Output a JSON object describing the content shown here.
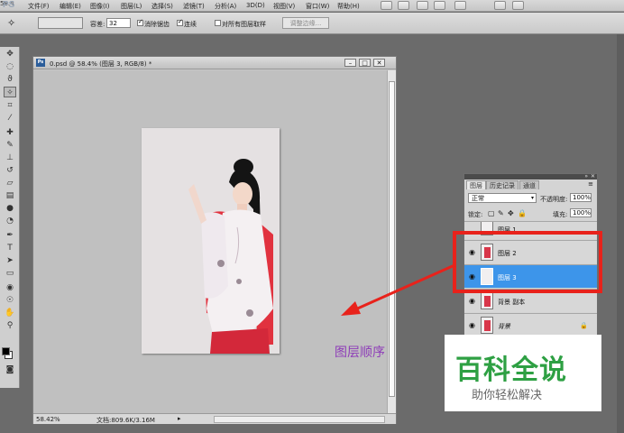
{
  "menubar": {
    "logo": "PS",
    "items": [
      "文件(F)",
      "编辑(E)",
      "图像(I)",
      "图层(L)",
      "选择(S)",
      "滤镜(T)",
      "分析(A)",
      "3D(D)",
      "视图(V)",
      "窗口(W)",
      "帮助(H)"
    ],
    "zoom": "58.4"
  },
  "options": {
    "tolerance_label": "容差:",
    "tolerance_value": "32",
    "antialias_label": "消除锯齿",
    "antialias_checked": true,
    "contiguous_label": "连续",
    "contiguous_checked": true,
    "sample_all_label": "对所有图层取样",
    "sample_all_checked": false,
    "refine_edge_label": "调整边缘..."
  },
  "document": {
    "title": "0.psd @ 58.4% (图层 3, RGB/8) *",
    "status_zoom": "58.42%",
    "status_doc": "文档:809.6K/3.16M"
  },
  "layers_panel": {
    "tabs": [
      "图层",
      "历史记录",
      "通道"
    ],
    "blend_mode": "正常",
    "opacity_label": "不透明度:",
    "opacity_value": "100%",
    "lock_label": "锁定:",
    "fill_label": "填充:",
    "fill_value": "100%",
    "layers": [
      {
        "name": "图层 1",
        "visible": false,
        "selected": false,
        "locked": false
      },
      {
        "name": "图层 2",
        "visible": true,
        "selected": false,
        "locked": false
      },
      {
        "name": "图层 3",
        "visible": true,
        "selected": true,
        "locked": false
      },
      {
        "name": "背景 副本",
        "visible": true,
        "selected": false,
        "locked": false
      },
      {
        "name": "背景",
        "visible": true,
        "selected": false,
        "locked": true
      }
    ]
  },
  "annotation": {
    "text": "图层顺序",
    "color": "#8e3db8",
    "highlight_color": "#e8221b"
  },
  "watermark": {
    "main": "百科全说",
    "sub": "助你轻松解决",
    "color": "#2ea043"
  }
}
